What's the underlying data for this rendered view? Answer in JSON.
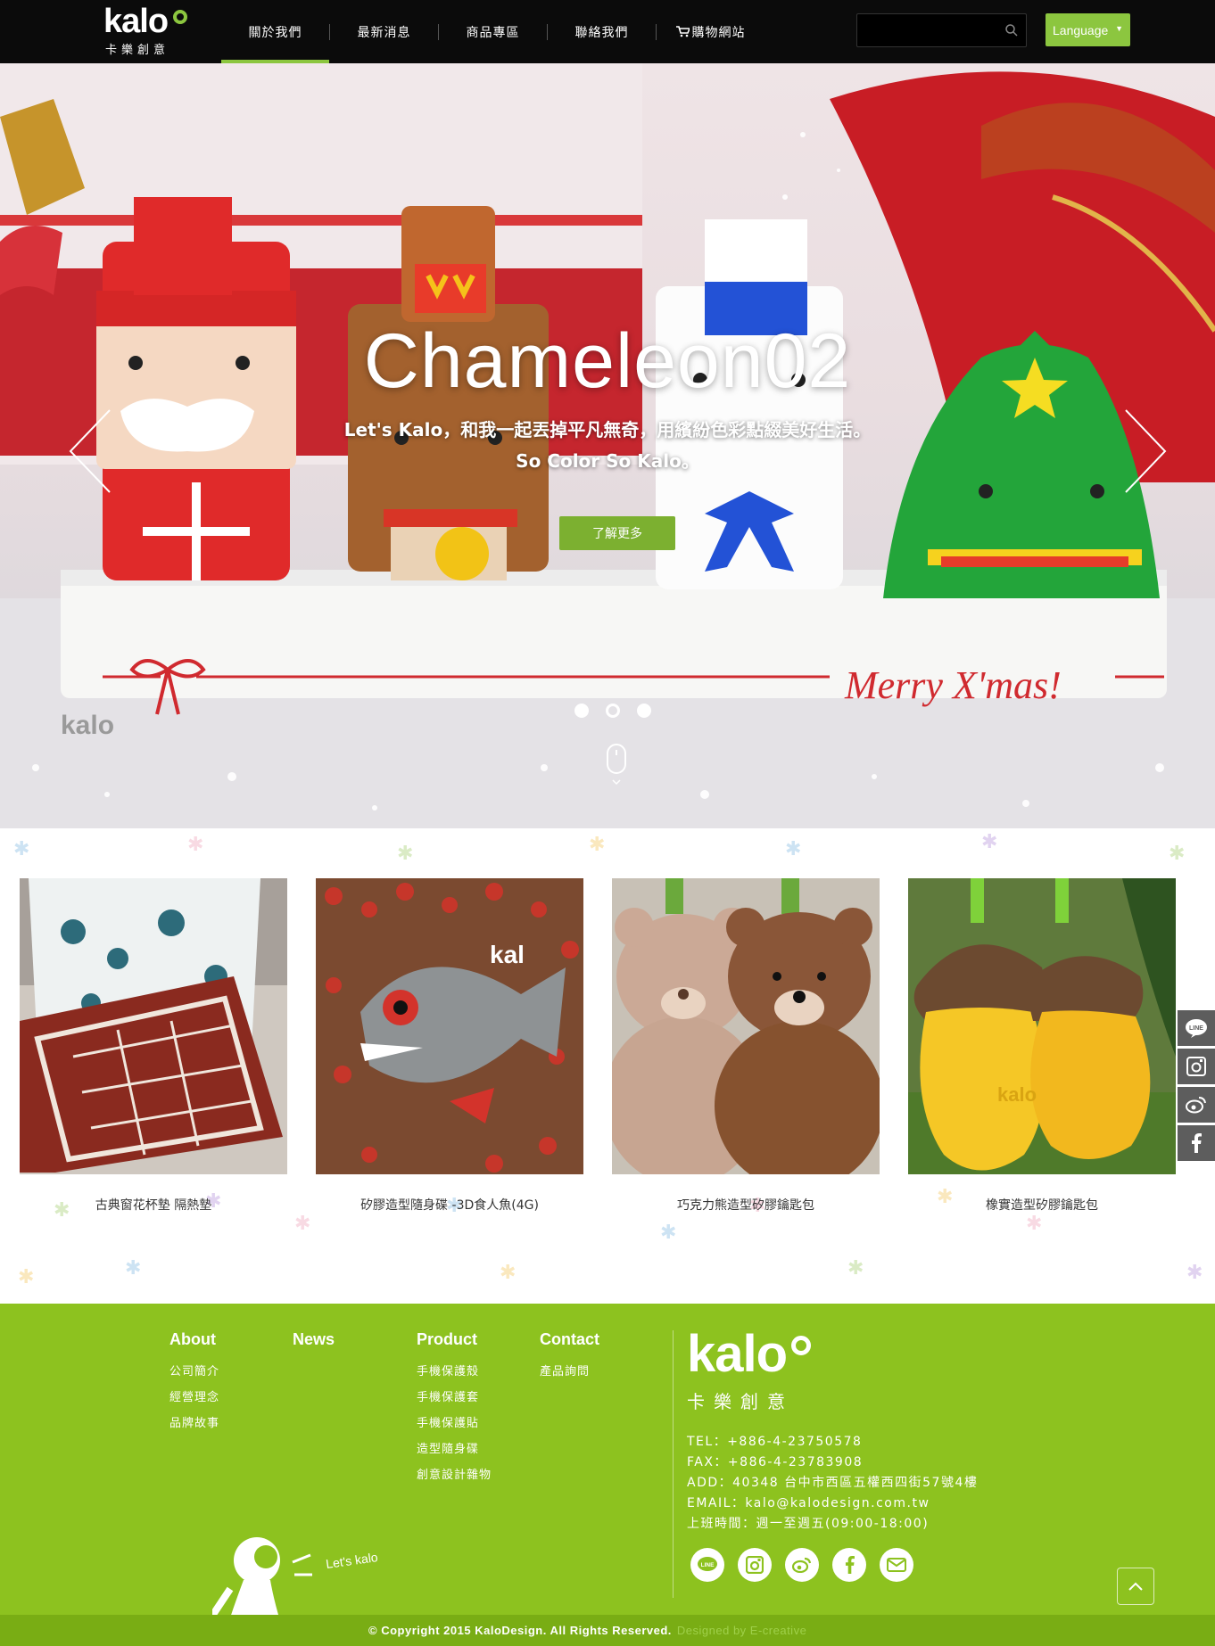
{
  "header": {
    "logo_text": "kalo",
    "logo_sub": "卡樂創意",
    "nav": [
      {
        "label": "關於我們",
        "active": true
      },
      {
        "label": "最新消息",
        "active": false
      },
      {
        "label": "商品專區",
        "active": false
      },
      {
        "label": "聯絡我們",
        "active": false
      },
      {
        "label": "購物網站",
        "active": false,
        "icon": "cart-icon"
      }
    ],
    "search_placeholder": "",
    "language_label": "Language"
  },
  "hero": {
    "title": "Chameleon02",
    "subtitle_line1": "Let's Kalo，和我一起丟掉平凡無奇，用繽紛色彩點綴美好生活。",
    "subtitle_line2": "So Color So Kalo。",
    "button_label": "了解更多",
    "scene_text": "Merry X'mas!",
    "slide_count": 3,
    "active_slide": 2
  },
  "products": [
    {
      "name": "古典窗花杯墊 隔熱墊"
    },
    {
      "name": "矽膠造型隨身碟 -3D食人魚(4G)"
    },
    {
      "name": "巧克力熊造型矽膠鑰匙包"
    },
    {
      "name": "橡實造型矽膠鑰匙包"
    }
  ],
  "side_social": [
    "line-icon",
    "instagram-icon",
    "weibo-icon",
    "facebook-icon"
  ],
  "footer": {
    "columns": [
      {
        "title": "About",
        "links": [
          "公司簡介",
          "經營理念",
          "品牌故事"
        ]
      },
      {
        "title": "News",
        "links": []
      },
      {
        "title": "Product",
        "links": [
          "手機保護殼",
          "手機保護套",
          "手機保護貼",
          "造型隨身碟",
          "創意設計雜物"
        ]
      },
      {
        "title": "Contact",
        "links": [
          "產品詢問"
        ]
      }
    ],
    "logo_text": "kalo",
    "logo_sub": "卡樂創意",
    "tel": "TEL：+886-4-23750578",
    "fax": "FAX：+886-4-23783908",
    "add": "ADD：40348 台中市西區五權西四街57號4樓",
    "email": "EMAIL：kalo@kalodesign.com.tw",
    "hours": "上班時間：週一至週五(09:00-18:00)",
    "social": [
      "line-icon",
      "instagram-icon",
      "weibo-icon",
      "facebook-icon",
      "mail-icon"
    ],
    "mascot_text": "Let's kalo",
    "copyright": "© Copyright 2015 KaloDesign. All Rights Reserved.",
    "designed_by": "Designed by E-creative"
  },
  "colors": {
    "brand_green": "#8dc21f",
    "header_bg": "#0b0b0b",
    "side_btn": "#5d5d5d"
  }
}
